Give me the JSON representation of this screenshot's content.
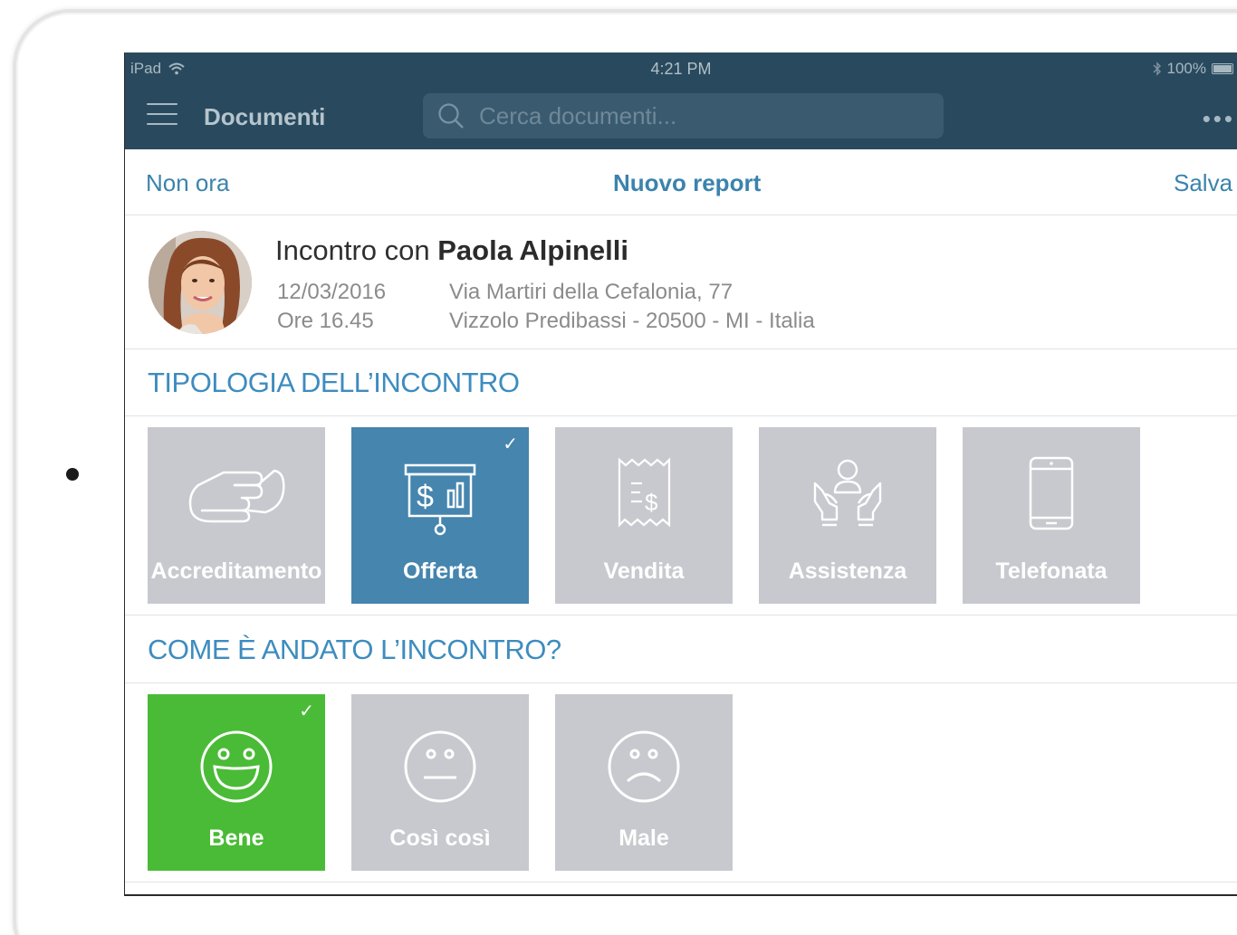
{
  "status_bar": {
    "device": "iPad",
    "time": "4:21 PM",
    "battery": "100%"
  },
  "nav": {
    "title": "Documenti",
    "search_placeholder": "Cerca documenti...",
    "more": "•••"
  },
  "action_bar": {
    "left": "Non ora",
    "title": "Nuovo report",
    "right": "Salva"
  },
  "meeting": {
    "prefix": "Incontro con",
    "name": "Paola Alpinelli",
    "date": "12/03/2016",
    "time": "Ore 16.45",
    "address_line1": "Via Martiri della Cefalonia, 77",
    "address_line2": "Vizzolo Predibassi - 20500 - MI - Italia"
  },
  "type_section": {
    "title": "TIPOLOGIA DELL’INCONTRO",
    "options": [
      {
        "label": "Accreditamento",
        "icon": "handshake-icon",
        "selected": false
      },
      {
        "label": "Offerta",
        "icon": "presentation-chart-icon",
        "selected": true
      },
      {
        "label": "Vendita",
        "icon": "receipt-icon",
        "selected": false
      },
      {
        "label": "Assistenza",
        "icon": "hands-person-icon",
        "selected": false
      },
      {
        "label": "Telefonata",
        "icon": "phone-icon",
        "selected": false
      }
    ]
  },
  "outcome_section": {
    "title": "COME È ANDATO L’INCONTRO?",
    "options": [
      {
        "label": "Bene",
        "icon": "happy-face-icon",
        "selected": true
      },
      {
        "label": "Così così",
        "icon": "neutral-face-icon",
        "selected": false
      },
      {
        "label": "Male",
        "icon": "sad-face-icon",
        "selected": false
      }
    ]
  },
  "colors": {
    "nav_bg": "#294a5e",
    "accent": "#3d8cbf",
    "selected_blue": "#4585ae",
    "selected_green": "#4abb36",
    "tile_gray": "#c8c9ce"
  }
}
